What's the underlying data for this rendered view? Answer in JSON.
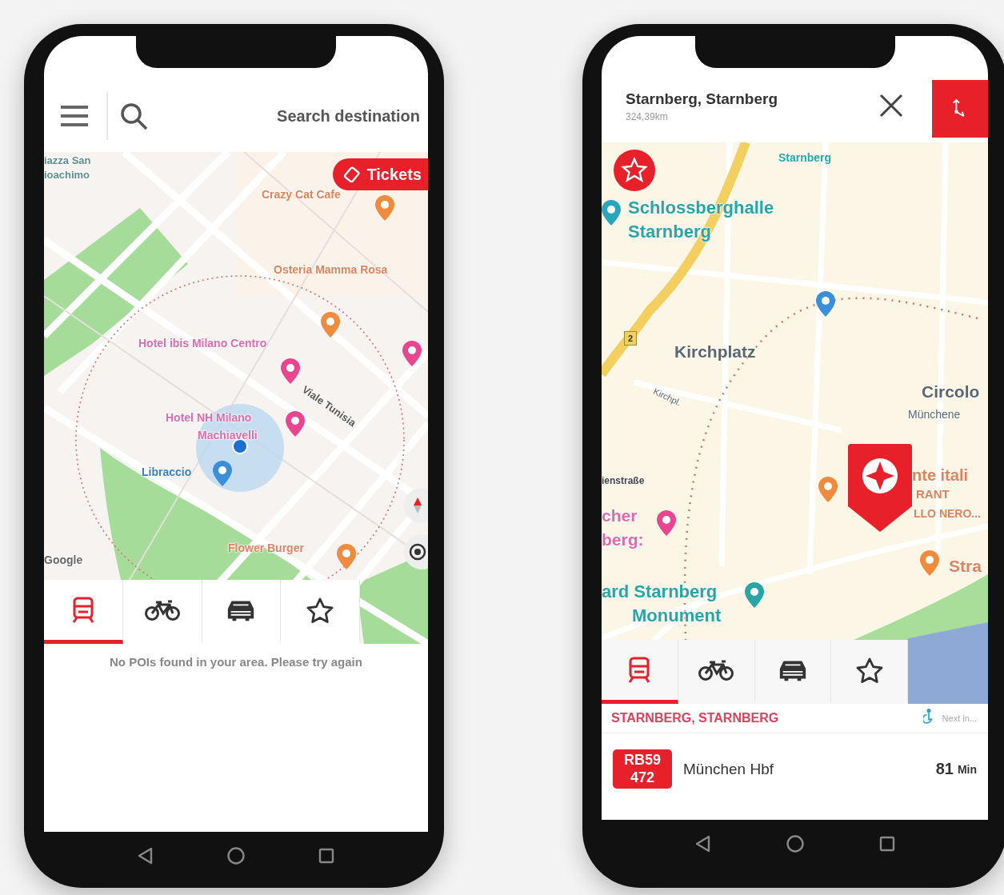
{
  "phones": [
    {
      "kind": "search",
      "search": {
        "placeholder": "Search destination"
      },
      "tickets_button": "Tickets",
      "map_labels": [
        {
          "text": "iazza San",
          "color": "#5f8c8c"
        },
        {
          "text": "ioachimo",
          "color": "#5f8c8c"
        },
        {
          "text": "Crazy Cat Cafe",
          "color": "#e0835a"
        },
        {
          "text": "Osteria Mamma Rosa",
          "color": "#e0835a"
        },
        {
          "text": "Hotel ibis Milano Centro",
          "color": "#e06aaa"
        },
        {
          "text": "Viale Tunisia",
          "color": "#555555"
        },
        {
          "text": "Hotel NH Milano",
          "color": "#e06aaa"
        },
        {
          "text": "Machiavelli",
          "color": "#e06aaa"
        },
        {
          "text": "Libraccio",
          "color": "#3d7fc4"
        },
        {
          "text": "Google",
          "color": "#666666"
        },
        {
          "text": "Flower Burger",
          "color": "#e0835a"
        }
      ],
      "map_pins": [
        {
          "color": "#f08a3c"
        },
        {
          "color": "#f08a3c"
        },
        {
          "color": "#e8468f"
        },
        {
          "color": "#e8468f"
        },
        {
          "color": "#e8468f"
        },
        {
          "color": "#3a8fd8"
        },
        {
          "color": "#f08a3c"
        }
      ],
      "tabs": [
        {
          "kind": "train",
          "selected": true
        },
        {
          "kind": "bike",
          "selected": false
        },
        {
          "kind": "car",
          "selected": false
        },
        {
          "kind": "star",
          "selected": false
        }
      ],
      "message": "No POIs found in your area. Please try again"
    },
    {
      "kind": "place",
      "title": "Starnberg, Starnberg",
      "distance": "324,39km",
      "road_badge": "2",
      "map_labels": [
        {
          "text": "Starnberg",
          "color": "#2aa5a5"
        },
        {
          "text": "Schlossberghalle",
          "color": "#2aa5a5"
        },
        {
          "text": "Starnberg",
          "color": "#2aa5a5"
        },
        {
          "text": "Kirchplatz",
          "color": "#5c6670"
        },
        {
          "text": "Kirchpl.",
          "color": "#5c6670"
        },
        {
          "text": "Circolo",
          "color": "#5c6670"
        },
        {
          "text": "Münchene",
          "color": "#5c6670"
        },
        {
          "text": "ienstraße",
          "color": "#444444"
        },
        {
          "text": "cher",
          "color": "#e06aaa"
        },
        {
          "text": "berg:",
          "color": "#e06aaa"
        },
        {
          "text": "nte itali",
          "color": "#e0835a"
        },
        {
          "text": "RANT",
          "color": "#e0835a"
        },
        {
          "text": "LLO NERO...",
          "color": "#e0835a"
        },
        {
          "text": "Stra",
          "color": "#e0835a"
        },
        {
          "text": "ard Starnberg",
          "color": "#2aa5a5"
        },
        {
          "text": "Monument",
          "color": "#2aa5a5"
        }
      ],
      "map_pins": [
        {
          "color": "#2aa5c0"
        },
        {
          "color": "#3a8fd8"
        },
        {
          "color": "#f08a3c"
        },
        {
          "color": "#e8468f"
        },
        {
          "color": "#f08a3c"
        },
        {
          "color": "#2aa5a5"
        }
      ],
      "tabs": [
        {
          "kind": "train",
          "selected": true
        },
        {
          "kind": "bike",
          "selected": false
        },
        {
          "kind": "car",
          "selected": false
        },
        {
          "kind": "star",
          "selected": false
        }
      ],
      "station": {
        "name": "STARNBERG, STARNBERG",
        "next": "Next in..."
      },
      "departure": {
        "line": "RB59",
        "number": "472",
        "destination": "München Hbf",
        "minutes": "81",
        "unit": "Min"
      }
    }
  ]
}
